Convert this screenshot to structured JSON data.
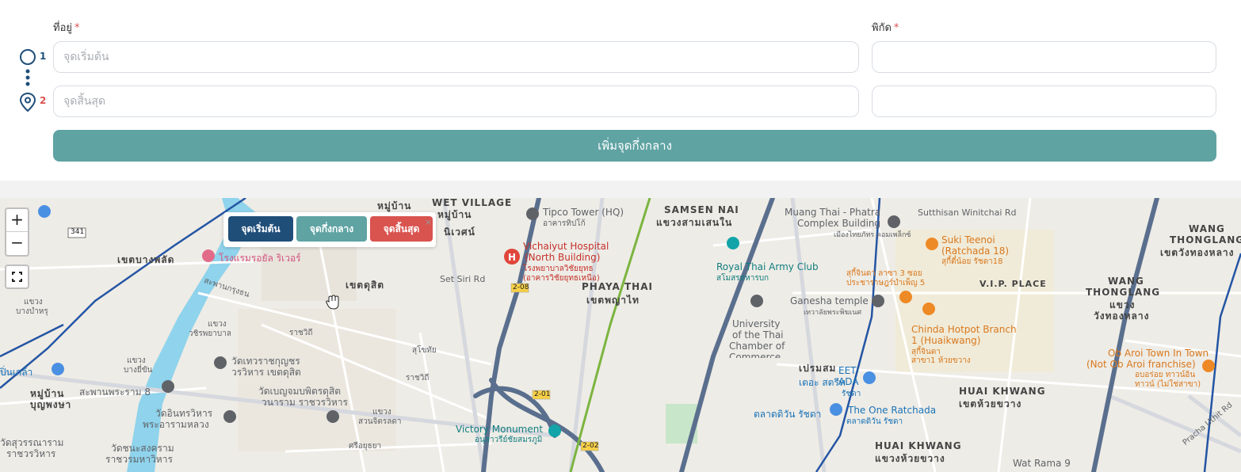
{
  "form": {
    "address_label": "ที่อยู่",
    "coord_label": "พิกัด",
    "required_mark": "*",
    "steps": [
      {
        "number": "1",
        "placeholder": "จุดเริ่มต้น",
        "coord_value": ""
      },
      {
        "number": "2",
        "placeholder": "จุดสิ้นสุด",
        "coord_value": ""
      }
    ],
    "add_waypoint_label": "เพิ่มจุดกึ่งกลาง"
  },
  "map": {
    "zoom_in": "+",
    "zoom_out": "−",
    "legend": {
      "start": "จุดเริ่มต้น",
      "middle": "จุดกึ่งกลาง",
      "end": "จุดสิ้นสุด",
      "close": "×"
    },
    "labels": {
      "l1": "หมู่บ้าน",
      "l2": "WET VILLAGE",
      "l3": "หมู่บ้าน",
      "l4": "นิเวศน์",
      "l5": "Tipco Tower (HQ)",
      "l6": "อาคารทิปโก้",
      "l7": "SAMSEN NAI",
      "l8": "แขวงสามเสนใน",
      "l9": "Muang Thai - Phatra",
      "l10": "Complex Building",
      "l11": "เมืองไทยภัทร คอมเพล็กซ์",
      "l12": "Sutthisan Winitchai Rd",
      "l13": "WANG",
      "l14": "THONGLANG",
      "l15": "เขตวังทองหลาง",
      "l16": "เขตบางพลัด",
      "l17": "โรงแรมรอยัล ริเวอร์",
      "l18": "Vichaiyut Hospital",
      "l19": "(North Building)",
      "l20": "โรงพยาบาลวิชัยยุทธ",
      "l21": "(อาคารวิชัยยุทธเหนือ)",
      "l22": "Suki Teenoi",
      "l23": "(Ratchada 18)",
      "l24": "สุกี้ตี๋น้อย รัชดา18",
      "l25": "Royal Thai Army Club",
      "l26": "สโมสรทหารบก",
      "l27": "สุกี้จินดา ลาซา 3 ซอย",
      "l28": "ประชาราษฎร์บำเพ็ญ 5",
      "l29": "V.I.P. PLACE",
      "l30": "เขตดุสิต",
      "l31": "Set Siri Rd",
      "l32": "PHAYA THAI",
      "l33": "เขตพญาไท",
      "l34": "Ganesha temple",
      "l35": "เทวาลัยพระพิฆเนศ",
      "l36": "WANG",
      "l37": "THONGLANG",
      "l38": "แขวง",
      "l39": "วังทองหลาง",
      "l40": "University",
      "l41": "of the Thai",
      "l42": "Chamber of",
      "l43": "Commerce",
      "l44": "Chinda Hotpot Branch",
      "l45": "1 (Huaikwang)",
      "l46": "สุกี้จินดา",
      "l47": "สาขา1 ห้วยขวาง",
      "l48": "Ob Aroi Town In Town",
      "l49": "(Not Ob Aroi franchise)",
      "l50": "อบอร่อย ทาวน์อิน",
      "l51": "ทาวน์ (ไม่ใช่สาขา)",
      "l52": "วัดเทวราชกุญชร",
      "l53": "วรวิหาร เขตดุสิต",
      "l54": "แขวง",
      "l55": "วชิรพยาบาล",
      "l56": "แขวง",
      "l57": "บางยี่ขัน",
      "l58": "วัดเบญจมบพิตรดุสิต",
      "l59": "วนาราม ราชวรวิหาร",
      "l60": "HUAI KHWANG",
      "l61": "เขตห้วยขวาง",
      "l62": "The One Ratchada",
      "l63": "ตลาดดิวัน รัชดา",
      "l64": "ตลาดดิวัน รัชดา",
      "l65": "หมู่บ้าน",
      "l66": "บุญพงษา",
      "l67": "สะพานพระราม 8",
      "l68": "วัดอินทรวิหาร",
      "l69": "พระอารามหลวง",
      "l70": "แขวง",
      "l71": "สวนจิตรลดา",
      "l72": "Victory Monument",
      "l73": "อนุสาวรีย์ชัยสมรภูมิ",
      "l74": "HUAI KHWANG",
      "l75": "แขวงห้วยขวาง",
      "l76": "Wat Rama 9",
      "l77": "Pracha Uthit Rd",
      "l78": "ปิ่นเกล้า",
      "l79": "วัดสุวรรณาราม",
      "l80": "ราชวรวิหาร",
      "l81": "วัดชนะสงคราม",
      "l82": "ราชวรมหาวิหาร",
      "l83": "แขวง",
      "l84": "บางบำหรุ",
      "l85": "2-08",
      "l86": "2-01",
      "l87": "2-02",
      "l88": "341",
      "l89": "เปรมสม",
      "l90": "EET",
      "l91": "ADA",
      "l92": "เตอะ สตรีท",
      "l93": "รัชดา",
      "l94": "สะพานกรุงธน",
      "l95": "ราชวิถี",
      "l96": "สุโขทัย",
      "l97": "ราชวิถี",
      "l98": "ศรีอยุธยา"
    }
  },
  "colors": {
    "start": "#1f4e79",
    "middle": "#5fa3a3",
    "end": "#d9534f",
    "add_button": "#5fa3a3",
    "river": "#8fd3ec",
    "rail": "#2455a4"
  }
}
